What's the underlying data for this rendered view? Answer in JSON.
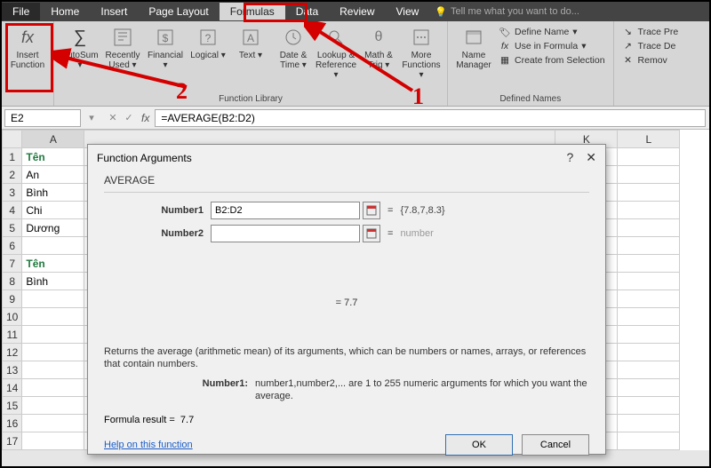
{
  "tabs": {
    "file": "File",
    "items": [
      "Home",
      "Insert",
      "Page Layout",
      "Formulas",
      "Data",
      "Review",
      "View"
    ],
    "active_index": 3,
    "tell_me": "Tell me what you want to do..."
  },
  "ribbon": {
    "function_library_label": "Function Library",
    "defined_names_label": "Defined Names",
    "insert_function": "Insert\nFunction",
    "autosum": "AutoSum",
    "recently_used": "Recently\nUsed",
    "financial": "Financial",
    "logical": "Logical",
    "text": "Text",
    "date_time": "Date &\nTime",
    "lookup_ref": "Lookup &\nReference",
    "math_trig": "Math &\nTrig",
    "more_functions": "More\nFunctions",
    "name_manager": "Name\nManager",
    "define_name": "Define Name",
    "use_in_formula": "Use in Formula",
    "create_from_selection": "Create from Selection",
    "trace_pre": "Trace Pre",
    "trace_de": "Trace De",
    "remov": "Remov"
  },
  "namebox": {
    "cell": "E2",
    "formula": "=AVERAGE(B2:D2)"
  },
  "columns": [
    "A",
    "K",
    "L"
  ],
  "rows": [
    "1",
    "2",
    "3",
    "4",
    "5",
    "6",
    "7",
    "8",
    "9",
    "10",
    "11",
    "12",
    "13",
    "14",
    "15",
    "16",
    "17"
  ],
  "cells": {
    "A1": "Tên",
    "A2": "An",
    "A3": "Bình",
    "A4": "Chi",
    "A5": "Dương",
    "A7": "Tên",
    "A8": "Bình"
  },
  "dialog": {
    "title": "Function Arguments",
    "fn_name": "AVERAGE",
    "number1_label": "Number1",
    "number1_value": "B2:D2",
    "number1_preview": "{7.8,7,8.3}",
    "number2_label": "Number2",
    "number2_value": "",
    "number2_preview": "number",
    "result_preview": "=   7.7",
    "description_main": "Returns the average (arithmetic mean) of its arguments, which can be numbers or names, arrays, or references that contain numbers.",
    "arg_help_label": "Number1:",
    "arg_help_text": "number1,number2,... are 1 to 255 numeric arguments for which you want the average.",
    "formula_result_label": "Formula result =",
    "formula_result_value": "7.7",
    "help_link": "Help on this function",
    "ok": "OK",
    "cancel": "Cancel"
  },
  "annotations": {
    "num1": "1",
    "num2": "2"
  }
}
